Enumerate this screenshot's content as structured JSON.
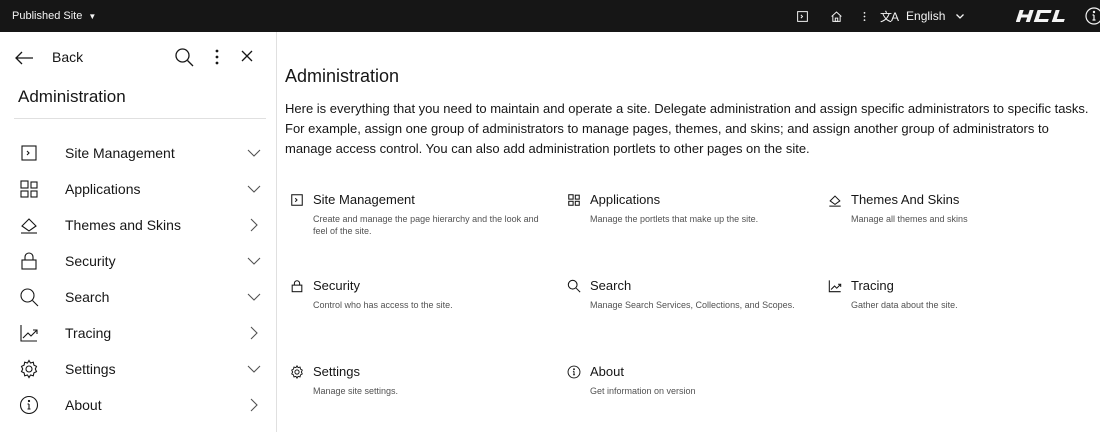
{
  "topbar": {
    "site_label": "Published Site",
    "language": "English"
  },
  "sidebar": {
    "back_label": "Back",
    "title": "Administration",
    "items": [
      {
        "label": "Site Management",
        "icon": "site-management-icon",
        "chevron": "down"
      },
      {
        "label": "Applications",
        "icon": "applications-icon",
        "chevron": "down"
      },
      {
        "label": "Themes and Skins",
        "icon": "themes-skins-icon",
        "chevron": "right"
      },
      {
        "label": "Security",
        "icon": "lock-icon",
        "chevron": "down"
      },
      {
        "label": "Search",
        "icon": "search-icon",
        "chevron": "down"
      },
      {
        "label": "Tracing",
        "icon": "tracing-icon",
        "chevron": "right"
      },
      {
        "label": "Settings",
        "icon": "gear-icon",
        "chevron": "down"
      },
      {
        "label": "About",
        "icon": "info-icon",
        "chevron": "right"
      }
    ]
  },
  "main": {
    "title": "Administration",
    "description_lines": [
      "Here is everything that you need to maintain and operate a site. Delegate administration and assign specific administrators to specific tasks.",
      "For example, assign one group of administrators to manage pages, themes, and skins; and assign another group of administrators to",
      "manage access control. You can also add administration portlets to other pages on the site."
    ],
    "cards": [
      {
        "title": "Site Management",
        "desc": "Create and manage the page hierarchy and the look and feel of the site.",
        "icon": "site-management-icon"
      },
      {
        "title": "Applications",
        "desc": "Manage the portlets that make up the site.",
        "icon": "applications-icon"
      },
      {
        "title": "Themes And Skins",
        "desc": "Manage all themes and skins",
        "icon": "themes-skins-icon"
      },
      {
        "title": "Security",
        "desc": "Control who has access to the site.",
        "icon": "lock-icon"
      },
      {
        "title": "Search",
        "desc": "Manage Search Services, Collections, and Scopes.",
        "icon": "search-icon"
      },
      {
        "title": "Tracing",
        "desc": "Gather data about the site.",
        "icon": "tracing-icon"
      },
      {
        "title": "Settings",
        "desc": "Manage site settings.",
        "icon": "gear-icon"
      },
      {
        "title": "About",
        "desc": "Get information on version",
        "icon": "info-icon"
      }
    ]
  },
  "colors": {
    "topbar_bg": "#161616",
    "text": "#161616",
    "secondary_text": "#525252",
    "divider": "#e0e0e0"
  }
}
